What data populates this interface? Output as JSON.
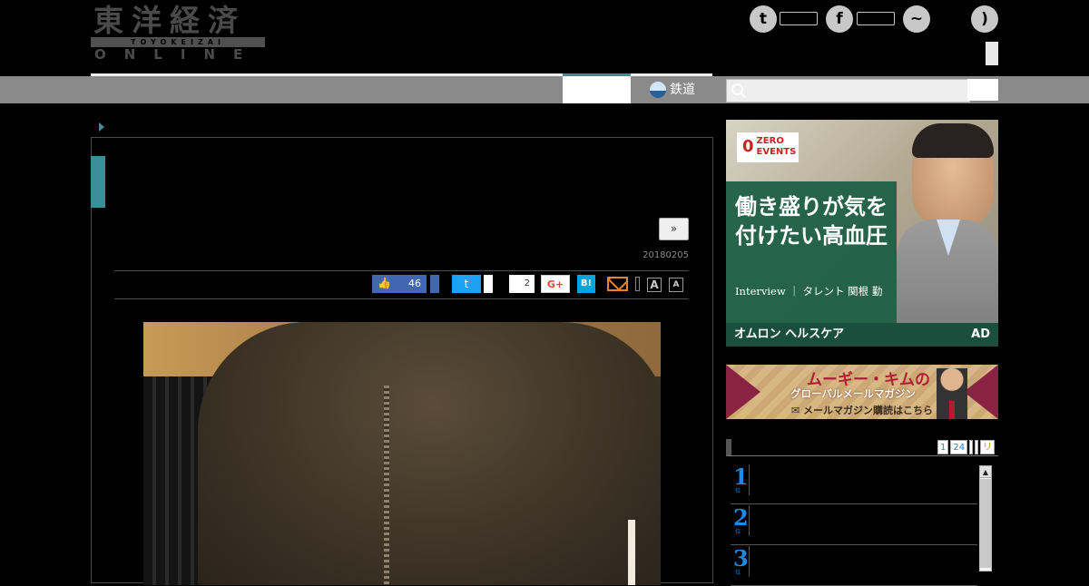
{
  "header": {
    "logo_kanji": "東洋経済",
    "logo_roman": "TOYOKEIZAI",
    "logo_online": "ONLINE"
  },
  "social": {
    "twitter_glyph": "t",
    "facebook_glyph": "f",
    "messenger_glyph": "~",
    "rss_glyph": ")"
  },
  "nav": {
    "rail_label": "鉄道"
  },
  "search": {
    "placeholder": ""
  },
  "article": {
    "next_label": "»",
    "date": "20180205"
  },
  "share": {
    "like_count": "46",
    "twitter_glyph": "t",
    "comment_count": "2",
    "gplus_label": "G+",
    "hatena_label": "B!",
    "font_large": "A",
    "font_small": "A"
  },
  "ads": {
    "zero_events": "ZERO EVENTS",
    "zero_mark": "0",
    "headline": "働き盛りが気を付けたい高血圧",
    "byline": "Interview ｜ タレント 関根 勤",
    "sponsor": "オムロン ヘルスケア",
    "ad_mark": "AD",
    "mag_title": "ムーギー・キムの",
    "mag_sub": "グローバルメールマガジン",
    "mag_cta": "✉ メールマガジン購読はこちら"
  },
  "ranking": {
    "tabs": [
      "1",
      "24",
      "",
      "",
      "リ"
    ],
    "items": [
      {
        "num": "1",
        "sub": "位"
      },
      {
        "num": "2",
        "sub": "位"
      },
      {
        "num": "3",
        "sub": "位"
      }
    ],
    "scroll_up": "▲"
  },
  "colors": {
    "accent_teal": "#3a8f99",
    "facebook": "#4267b2",
    "twitter": "#1da1f2",
    "rank_blue": "#1e88e5"
  }
}
